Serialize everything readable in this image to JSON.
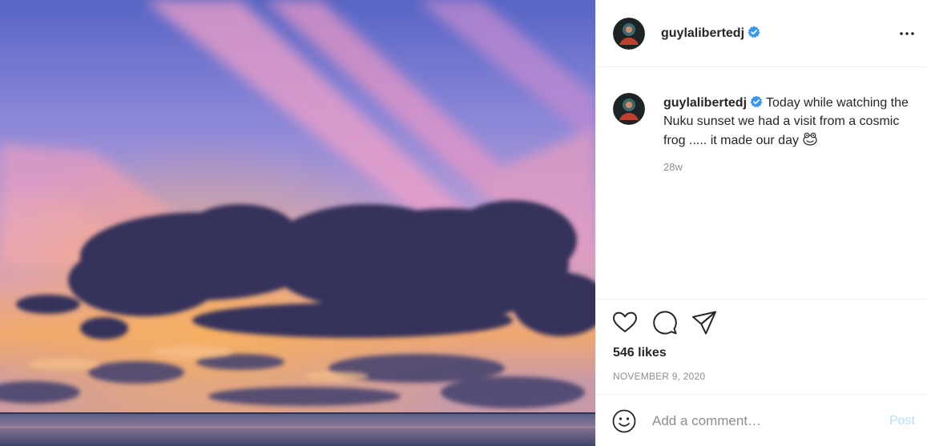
{
  "post": {
    "image_alt": "Sunset sky with pink and violet streaks over the sea with a dark cloud bank",
    "colors": {
      "sky_top": "#5b66c8",
      "sky_pink": "#e8a0c8",
      "sunset_orange": "#f2a455",
      "cloud_dark": "#3a3760",
      "sea": "#4b5276"
    }
  },
  "header": {
    "username": "guylalibertedj",
    "verified_icon": "verified-badge-icon",
    "more_icon": "more-options-icon"
  },
  "caption": {
    "username": "guylalibertedj",
    "text": "Today while watching the Nuku sunset we had a visit from a cosmic frog ..... it made our day",
    "emoji": "frog-emoji",
    "age": "28w"
  },
  "actions": {
    "like_icon": "heart-icon",
    "comment_icon": "comment-icon",
    "share_icon": "share-icon"
  },
  "likes": "546 likes",
  "date": "NOVEMBER 9, 2020",
  "comment_box": {
    "emoji_icon": "smiley-icon",
    "placeholder": "Add a comment…",
    "post_label": "Post",
    "post_color": "#b2dffc"
  }
}
